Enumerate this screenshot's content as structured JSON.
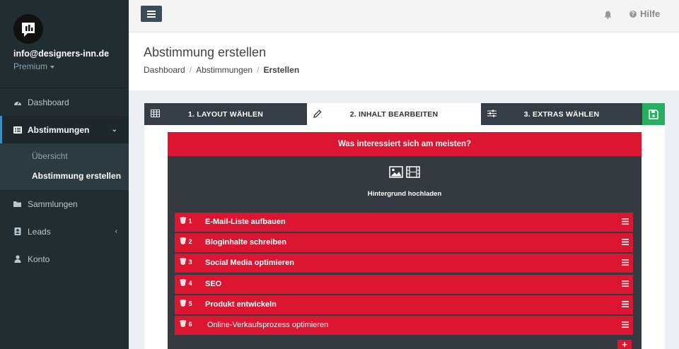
{
  "profile": {
    "email": "info@designers-inn.de",
    "plan": "Premium"
  },
  "nav": {
    "items": [
      {
        "label": "Dashboard",
        "icon": "dashboard-icon"
      },
      {
        "label": "Abstimmungen",
        "icon": "list-icon"
      },
      {
        "label": "Sammlungen",
        "icon": "folder-icon"
      },
      {
        "label": "Leads",
        "icon": "contact-book-icon"
      },
      {
        "label": "Konto",
        "icon": "user-icon"
      }
    ],
    "subitems": [
      {
        "label": "Übersicht"
      },
      {
        "label": "Abstimmung erstellen"
      }
    ]
  },
  "topbar": {
    "help_label": "Hilfe"
  },
  "header": {
    "title": "Abstimmung erstellen",
    "breadcrumb": [
      "Dashboard",
      "Abstimmungen",
      "Erstellen"
    ]
  },
  "tabs": [
    {
      "label": "1. LAYOUT WÄHLEN",
      "icon": "table-icon"
    },
    {
      "label": "2. INHALT BEARBEITEN",
      "icon": "pencil-icon"
    },
    {
      "label": "3. EXTRAS WÄHLEN",
      "icon": "sliders-icon"
    }
  ],
  "editor": {
    "question": "Was interessiert sich am meisten?",
    "background_label": "Hintergrund hochladen",
    "answers": [
      {
        "num": "1",
        "text": "E-Mail-Liste aufbauen"
      },
      {
        "num": "2",
        "text": "Bloginhalte schreiben"
      },
      {
        "num": "3",
        "text": "Social Media optimieren"
      },
      {
        "num": "4",
        "text": "SEO"
      },
      {
        "num": "5",
        "text": "Produkt entwickeln"
      },
      {
        "num": "6",
        "text": "Online-Verkaufsprozess optimieren"
      }
    ],
    "add_label": "+"
  },
  "colors": {
    "sidebar": "#222d32",
    "accent_red": "#dc1530",
    "dark_panel": "#343a40",
    "save_green": "#27ae60"
  }
}
